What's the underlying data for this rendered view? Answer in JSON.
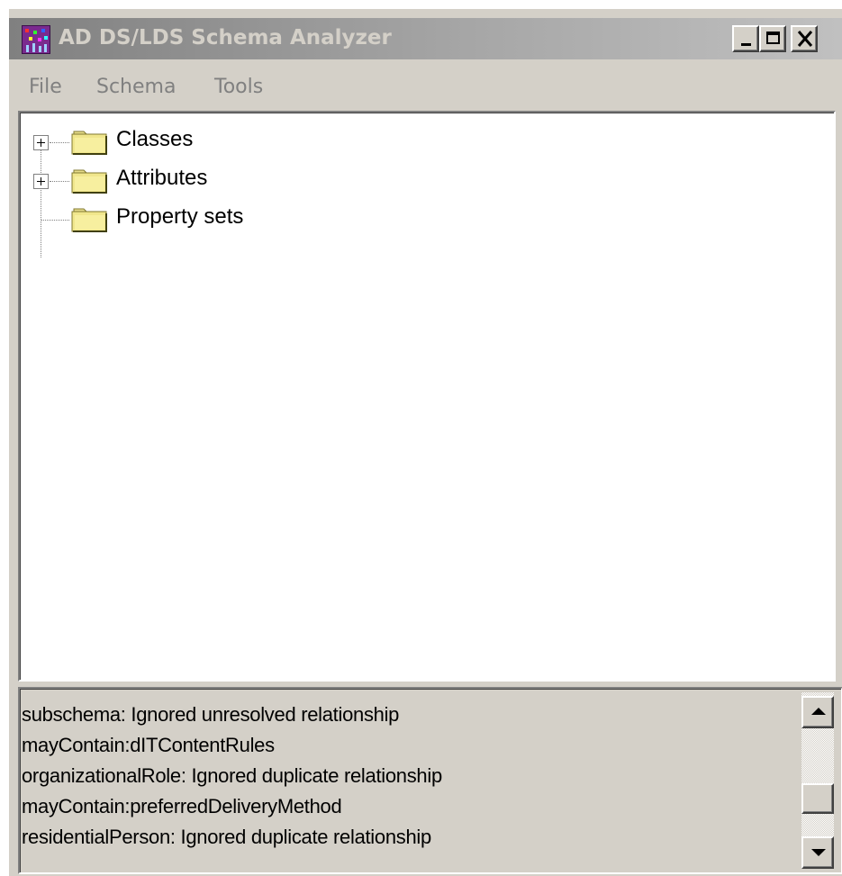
{
  "window": {
    "title": "AD DS/LDS Schema Analyzer",
    "icon": "schema-analyzer-app-icon"
  },
  "caption_buttons": {
    "minimize_icon": "minimize-icon",
    "maximize_icon": "maximize-icon",
    "close_icon": "close-icon"
  },
  "menu": {
    "items": [
      {
        "label": "File"
      },
      {
        "label": "Schema"
      },
      {
        "label": "Tools"
      }
    ],
    "enabled": false
  },
  "tree": {
    "nodes": [
      {
        "label": "Classes",
        "expandable": true,
        "icon": "folder-icon"
      },
      {
        "label": "Attributes",
        "expandable": true,
        "icon": "folder-icon"
      },
      {
        "label": "Property sets",
        "expandable": false,
        "icon": "folder-icon"
      }
    ]
  },
  "log": {
    "lines": [
      "subschema: Ignored unresolved relationship",
      "mayContain:dITContentRules",
      "organizationalRole: Ignored duplicate relationship",
      "mayContain:preferredDeliveryMethod",
      "residentialPerson: Ignored duplicate relationship"
    ],
    "scroll_position": 0.85
  },
  "colors": {
    "titlebar_inactive_start": "#808080",
    "titlebar_inactive_end": "#c0c0c0",
    "title_text": "#d4d0c8",
    "face": "#d4d0c8",
    "folder": "#f0e68c"
  }
}
